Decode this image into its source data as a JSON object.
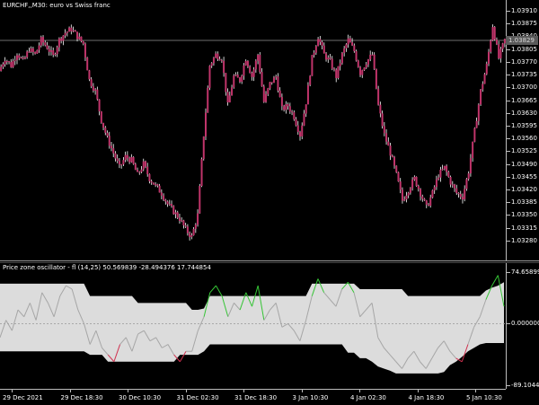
{
  "price_chart": {
    "title": "EURCHF,,M30:  euro vs Swiss franc",
    "current_price": "1.03829",
    "axis_labels": [
      "1.03910",
      "1.03875",
      "1.03840",
      "1.03805",
      "1.03770",
      "1.03735",
      "1.03700",
      "1.03665",
      "1.03630",
      "1.03595",
      "1.03560",
      "1.03525",
      "1.03490",
      "1.03455",
      "1.03420",
      "1.03385",
      "1.03350",
      "1.03315",
      "1.03280"
    ],
    "ylim": [
      1.0326,
      1.0392
    ],
    "colors": {
      "candle": "#c0346a",
      "wick": "#ffffff",
      "price_line": "#6e6e6e"
    },
    "closes": [
      1.03745,
      1.0378,
      1.0376,
      1.03795,
      1.0377,
      1.03805,
      1.0379,
      1.0383,
      1.0381,
      1.03785,
      1.0383,
      1.0385,
      1.0386,
      1.0384,
      1.0382,
      1.0372,
      1.0369,
      1.0361,
      1.0356,
      1.0352,
      1.0348,
      1.0351,
      1.035,
      1.0346,
      1.0349,
      1.0345,
      1.0343,
      1.0341,
      1.0338,
      1.0336,
      1.0334,
      1.0331,
      1.0329,
      1.0335,
      1.0357,
      1.0376,
      1.0379,
      1.0378,
      1.0365,
      1.0373,
      1.0372,
      1.0378,
      1.0373,
      1.0379,
      1.0366,
      1.0371,
      1.0373,
      1.0364,
      1.0365,
      1.0362,
      1.0357,
      1.0366,
      1.0378,
      1.0384,
      1.0379,
      1.0377,
      1.0373,
      1.0379,
      1.0383,
      1.038,
      1.0374,
      1.0377,
      1.0379,
      1.0365,
      1.0357,
      1.0352,
      1.0346,
      1.0339,
      1.0342,
      1.0345,
      1.0341,
      1.0337,
      1.0341,
      1.0346,
      1.0348,
      1.0344,
      1.0341,
      1.034,
      1.0347,
      1.0358,
      1.0369,
      1.0376,
      1.0387,
      1.0378,
      1.0383
    ]
  },
  "oscillator": {
    "title": "Price zone oscillator - fl (14,25) 50.569839 -28.494376 17.744854",
    "axis_labels": [
      "74.658996",
      "0.000000",
      "-89.104423"
    ],
    "ylim": [
      -89.104423,
      74.658996
    ],
    "zero_line": 0,
    "colors": {
      "band_fill": "#dcdcdc",
      "line": "#a6a6a6",
      "up": "#35c435",
      "down": "#d0314f",
      "neutral": "#ffffff",
      "zero": "#a0a0a0"
    },
    "upper": [
      58,
      58,
      58,
      58,
      58,
      58,
      58,
      58,
      58,
      58,
      58,
      58,
      58,
      58,
      58,
      40,
      40,
      40,
      40,
      40,
      40,
      40,
      40,
      30,
      30,
      30,
      30,
      30,
      30,
      30,
      30,
      30,
      20,
      20,
      22,
      40,
      40,
      40,
      40,
      40,
      40,
      40,
      40,
      40,
      40,
      40,
      40,
      40,
      40,
      40,
      40,
      40,
      58,
      58,
      58,
      58,
      58,
      58,
      58,
      58,
      50,
      50,
      50,
      50,
      50,
      50,
      50,
      50,
      40,
      40,
      40,
      40,
      40,
      40,
      40,
      40,
      40,
      40,
      40,
      40,
      40,
      48,
      52,
      55,
      60
    ],
    "lower": [
      -40,
      -40,
      -40,
      -40,
      -40,
      -40,
      -40,
      -40,
      -40,
      -40,
      -40,
      -40,
      -40,
      -40,
      -40,
      -45,
      -45,
      -45,
      -55,
      -55,
      -55,
      -55,
      -55,
      -55,
      -55,
      -55,
      -55,
      -55,
      -55,
      -55,
      -45,
      -45,
      -45,
      -45,
      -40,
      -30,
      -30,
      -30,
      -30,
      -30,
      -30,
      -30,
      -30,
      -30,
      -30,
      -30,
      -30,
      -30,
      -30,
      -30,
      -30,
      -30,
      -30,
      -30,
      -30,
      -30,
      -30,
      -30,
      -42,
      -42,
      -50,
      -50,
      -55,
      -62,
      -65,
      -68,
      -72,
      -72,
      -72,
      -72,
      -72,
      -72,
      -72,
      -72,
      -70,
      -60,
      -55,
      -48,
      -40,
      -35,
      -30,
      -28,
      -28,
      -28,
      -28
    ],
    "values": [
      -20,
      5,
      -10,
      20,
      10,
      30,
      5,
      45,
      30,
      10,
      40,
      55,
      50,
      20,
      0,
      -30,
      -10,
      -35,
      -45,
      -55,
      -30,
      -20,
      -40,
      -15,
      -10,
      -25,
      -20,
      -35,
      -30,
      -45,
      -55,
      -40,
      -40,
      -10,
      10,
      45,
      55,
      40,
      10,
      30,
      20,
      45,
      25,
      55,
      5,
      20,
      30,
      -5,
      0,
      -10,
      -25,
      5,
      40,
      65,
      45,
      35,
      25,
      50,
      60,
      45,
      10,
      20,
      30,
      -20,
      -35,
      -45,
      -55,
      -65,
      -50,
      -40,
      -55,
      -65,
      -50,
      -35,
      -25,
      -40,
      -50,
      -55,
      -30,
      -5,
      10,
      35,
      55,
      70,
      25
    ]
  },
  "time_axis": [
    "29 Dec 2021",
    "29 Dec 18:30",
    "30 Dec 10:30",
    "31 Dec 02:30",
    "31 Dec 18:30",
    "3 Jan 10:30",
    "4 Jan 02:30",
    "4 Jan 18:30",
    "5 Jan 10:30"
  ]
}
